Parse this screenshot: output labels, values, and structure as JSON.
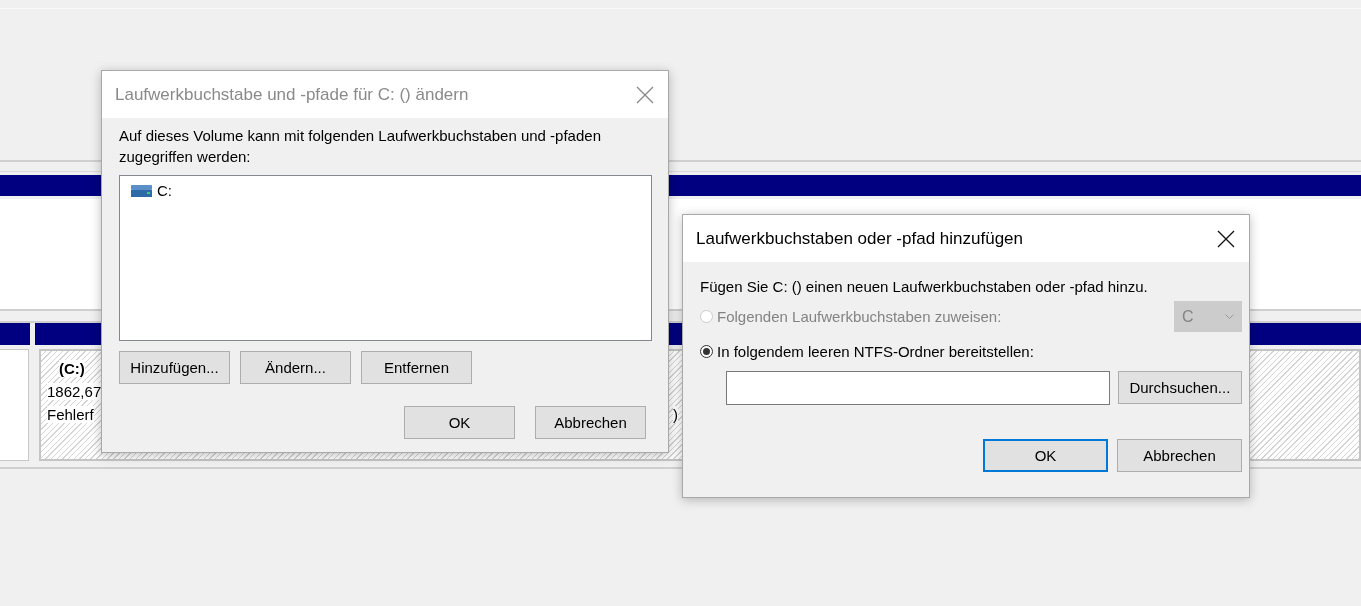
{
  "disk_map": {
    "volume_label": "(C:)",
    "size": "1862,67",
    "status": "Fehlerf",
    "status_tail": ")"
  },
  "dialogs": [
    {
      "title": "Laufwerkbuchstabe und -pfade für C: () ändern",
      "active": false,
      "description": "Auf dieses Volume kann mit folgenden Laufwerkbuchstaben und -pfaden zugegriffen werden:",
      "list": [
        {
          "label": "C:",
          "selected": false
        }
      ],
      "actions": [
        {
          "label": "Hinzufügen...",
          "default": false
        },
        {
          "label": "Ändern...",
          "default": false
        },
        {
          "label": "Entfernen",
          "default": false
        }
      ],
      "buttons": [
        {
          "label": "OK",
          "default": false
        },
        {
          "label": "Abbrechen",
          "default": false
        }
      ]
    },
    {
      "title": "Laufwerkbuchstaben oder -pfad hinzufügen",
      "active": true,
      "description": "Fügen Sie C: () einen neuen Laufwerkbuchstaben oder -pfad hinzu.",
      "options": [
        {
          "kind": "letter",
          "label": "Folgenden Laufwerkbuchstaben zuweisen:",
          "selected": false,
          "disabled": true,
          "value": "C"
        },
        {
          "kind": "folder",
          "label": "In folgendem leeren NTFS-Ordner bereitstellen:",
          "selected": true,
          "disabled": false,
          "browse": "Durchsuchen..."
        }
      ],
      "buttons": [
        {
          "label": "OK",
          "default": true
        },
        {
          "label": "Abbrechen",
          "default": false
        }
      ]
    }
  ]
}
